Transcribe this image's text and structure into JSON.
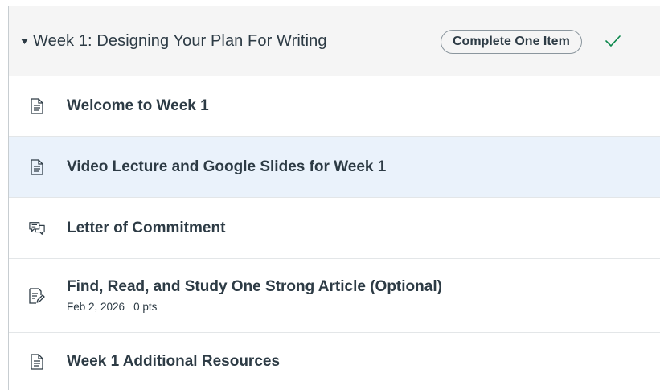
{
  "module": {
    "title": "Week 1: Designing Your Plan For Writing",
    "requirement": "Complete One Item",
    "collapse_icon": "triangle-down-icon",
    "status_icon": "checkmark-icon",
    "accent_color": "#0b874b",
    "highlight_color": "#eaf2fb"
  },
  "items": [
    {
      "title": "Welcome to Week 1",
      "icon": "page-icon"
    },
    {
      "title": "Video Lecture and Google Slides for Week 1",
      "icon": "page-icon"
    },
    {
      "title": "Letter of Commitment",
      "icon": "discussion-icon"
    },
    {
      "title": "Find, Read, and Study One Strong Article (Optional)",
      "icon": "assignment-icon",
      "due_date": "Feb 2, 2026",
      "points": "0 pts"
    },
    {
      "title": "Week 1 Additional Resources",
      "icon": "page-icon"
    }
  ]
}
